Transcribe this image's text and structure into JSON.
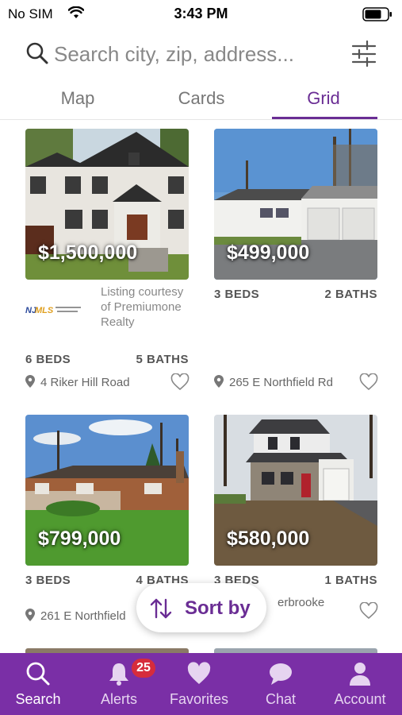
{
  "status_bar": {
    "carrier": "No SIM",
    "time": "3:43 PM"
  },
  "search": {
    "placeholder": "Search city, zip, address..."
  },
  "tabs": [
    {
      "label": "Map",
      "active": false
    },
    {
      "label": "Cards",
      "active": false
    },
    {
      "label": "Grid",
      "active": true
    }
  ],
  "listings": [
    {
      "price": "$1,500,000",
      "beds": "6 BEDS",
      "baths": "5 BATHS",
      "address": "4 Riker Hill Road",
      "courtesy": "Listing courtesy of Premiumone Realty",
      "mls_logo_text": "NJMLS"
    },
    {
      "price": "$499,000",
      "beds": "3 BEDS",
      "baths": "2 BATHS",
      "address": "265 E Northfield Rd"
    },
    {
      "price": "$799,000",
      "beds": "3 BEDS",
      "baths": "4 BATHS",
      "address": "261 E Northfield"
    },
    {
      "price": "$580,000",
      "beds": "3 BEDS",
      "baths": "1 BATHS",
      "address": "erbrooke"
    }
  ],
  "sort": {
    "label": "Sort by"
  },
  "tab_bar": {
    "items": [
      {
        "label": "Search",
        "icon": "search-icon",
        "active": true
      },
      {
        "label": "Alerts",
        "icon": "bell-icon",
        "badge": "25"
      },
      {
        "label": "Favorites",
        "icon": "heart-icon"
      },
      {
        "label": "Chat",
        "icon": "chat-bubble-icon"
      },
      {
        "label": "Account",
        "icon": "person-icon"
      }
    ]
  },
  "colors": {
    "accent": "#6a2d94",
    "tab_bar_bg": "#7a2fa6",
    "badge": "#d62c3c"
  }
}
